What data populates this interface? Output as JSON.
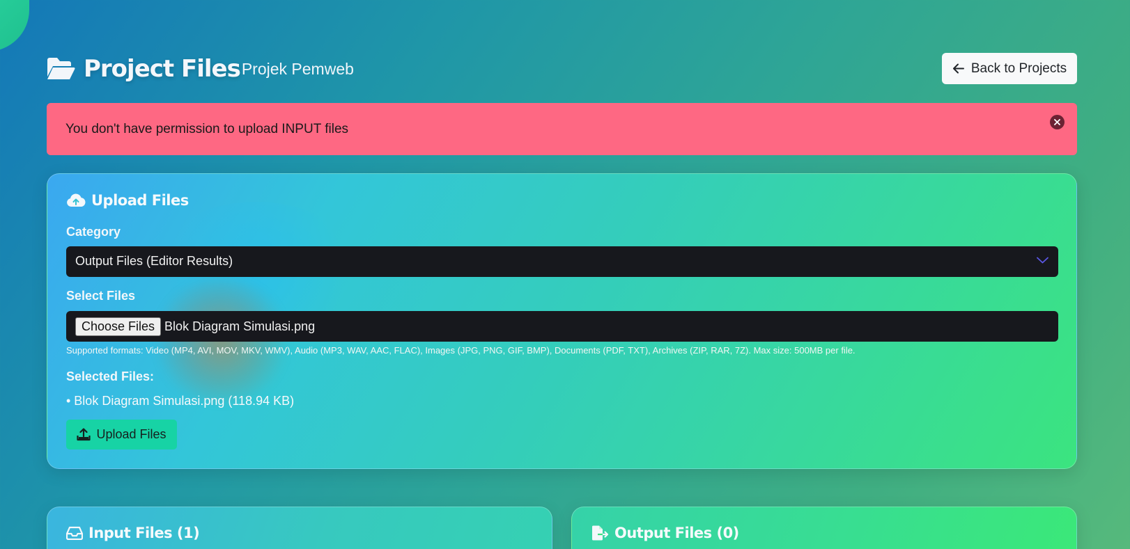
{
  "header": {
    "title": "Project Files",
    "subtitle": "Projek Pemweb",
    "back_label": "Back to Projects"
  },
  "alert": {
    "message": "You don't have permission to upload INPUT files"
  },
  "upload": {
    "title": "Upload Files",
    "category_label": "Category",
    "category_value": "Output Files (Editor Results)",
    "select_label": "Select Files",
    "choose_label": "Choose Files",
    "chosen_file": "Blok Diagram Simulasi.png",
    "help_text": "Supported formats: Video (MP4, AVI, MOV, MKV, WMV), Audio (MP3, WAV, AAC, FLAC), Images (JPG, PNG, GIF, BMP), Documents (PDF, TXT), Archives (ZIP, RAR, 7Z). Max size: 500MB per file.",
    "selected_label": "Selected Files:",
    "selected_items": [
      "• Blok Diagram Simulasi.png (118.94 KB)"
    ],
    "submit_label": "Upload Files"
  },
  "input_files": {
    "title": "Input Files (1)"
  },
  "output_files": {
    "title": "Output Files (0)"
  },
  "colors": {
    "alert_bg": "#fe6883",
    "select_bg": "#17181d",
    "upload_button_bg": "#17d3a5",
    "chevron": "#5b57e6"
  }
}
